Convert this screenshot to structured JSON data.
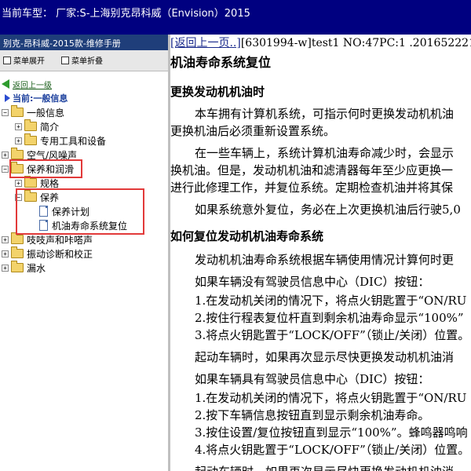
{
  "window": {
    "title": "当前车型： 厂家:S-上海别克昂科威（Envision）2015"
  },
  "left_panel": {
    "header": "别克-昂科威-2015款-维修手册",
    "toolbar": {
      "expand_label": "菜单展开",
      "collapse_label": "菜单折叠"
    },
    "back_link": "返回上一级",
    "current_label": "当前:一般信息",
    "tree": [
      {
        "label": "一般信息",
        "expanded": true
      },
      {
        "label": "简介"
      },
      {
        "label": "专用工具和设备"
      },
      {
        "label": "空气/风噪声"
      },
      {
        "label": "保养和润滑",
        "expanded": true
      },
      {
        "label": "规格"
      },
      {
        "label": "保养",
        "expanded": true
      },
      {
        "label": "保养计划"
      },
      {
        "label": "机油寿命系统复位"
      },
      {
        "label": "吱吱声和咔嗒声"
      },
      {
        "label": "振动诊断和校正"
      },
      {
        "label": "漏水"
      }
    ]
  },
  "content": {
    "nav_link": "[返回上一页..]",
    "nav_info": "[6301994-w]test1 NO:47PC:1 .2016522216",
    "title": "机油寿命系统复位",
    "section1_title": "更换发动机机油时",
    "p1_l1": "本车拥有计算机系统，可指示何时更换发动机机油",
    "p1_l2": "更换机油后必须重新设置系统。",
    "p2_l1": "在一些车辆上，系统计算机油寿命减少时，会显示",
    "p2_l2": "换机油。但是，发动机机油和滤清器每年至少应更换一",
    "p2_l3": "进行此修理工作，并复位系统。定期检查机油并将其保",
    "p3": "如果系统意外复位，务必在上次更换机油后行驶5,0",
    "section2_title": "如何复位发动机机油寿命系统",
    "p4": "发动机机油寿命系统根据车辆使用情况计算何时更",
    "p5": "如果车辆没有驾驶员信息中心（DIC）按钮：",
    "step1a": "1.在发动机关闭的情况下，将点火钥匙置于“ON/RU",
    "step2a": "2.按住行程表复位杆直到剩余机油寿命显示“100%”",
    "step3a": "3.将点火钥匙置于“LOCK/OFF”（锁止/关闭）位置。",
    "p6": "起动车辆时，如果再次显示尽快更换发动机机油消",
    "p7": "如果车辆具有驾驶员信息中心（DIC）按钮：",
    "step1b": "1.在发动机关闭的情况下，将点火钥匙置于“ON/RU",
    "step2b": "2.按下车辆信息按钮直到显示剩余机油寿命。",
    "step3b": "3.按住设置/复位按钮直到显示“100%”。蜂鸣器鸣响",
    "step4b": "4.将点火钥匙置于“LOCK/OFF”（锁止/关闭）位置。",
    "p8": "起动车辆时，如果再次显示尽快更换发动机机油消"
  }
}
